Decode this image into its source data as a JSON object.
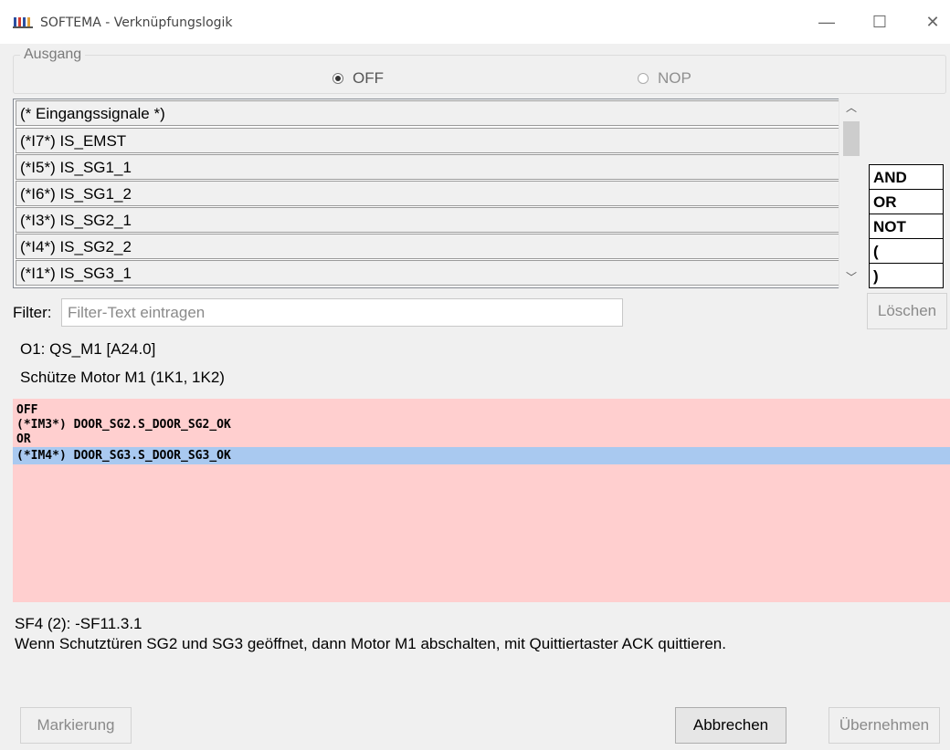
{
  "window": {
    "title": "SOFTEMA - Verknüpfungslogik",
    "minimize": "—",
    "maximize": "☐",
    "close": "✕"
  },
  "ausgang": {
    "label": "Ausgang",
    "options": [
      {
        "label": "OFF",
        "selected": true
      },
      {
        "label": "NOP",
        "selected": false
      }
    ]
  },
  "signals": [
    "(* Eingangssignale *)",
    "(*I7*) IS_EMST",
    "(*I5*) IS_SG1_1",
    "(*I6*) IS_SG1_2",
    "(*I3*) IS_SG2_1",
    "(*I4*) IS_SG2_2",
    "(*I1*) IS_SG3_1"
  ],
  "operators": [
    "AND",
    "OR",
    "NOT",
    "(",
    ")"
  ],
  "filter": {
    "label": "Filter:",
    "placeholder": "Filter-Text eintragen",
    "value": ""
  },
  "buttons": {
    "delete": "Löschen",
    "mark": "Markierung",
    "cancel": "Abbrechen",
    "apply": "Übernehmen"
  },
  "output": {
    "id": "O1: QS_M1 [A24.0]",
    "description": "Schütze Motor M1 (1K1, 1K2)"
  },
  "logic_lines": [
    {
      "text": "OFF",
      "selected": false
    },
    {
      "text": "(*IM3*) DOOR_SG2.S_DOOR_SG2_OK",
      "selected": false
    },
    {
      "text": "OR",
      "selected": false
    },
    {
      "text": "(*IM4*) DOOR_SG3.S_DOOR_SG3_OK",
      "selected": true
    }
  ],
  "safety_function": {
    "id": "SF4 (2): -SF11.3.1",
    "text": "Wenn Schutztüren SG2 und SG3 geöffnet, dann Motor M1 abschalten, mit Quittiertaster ACK quittieren."
  },
  "colors": {
    "logic_background": "#ffcfcf",
    "selection": "#a9c9f0"
  }
}
